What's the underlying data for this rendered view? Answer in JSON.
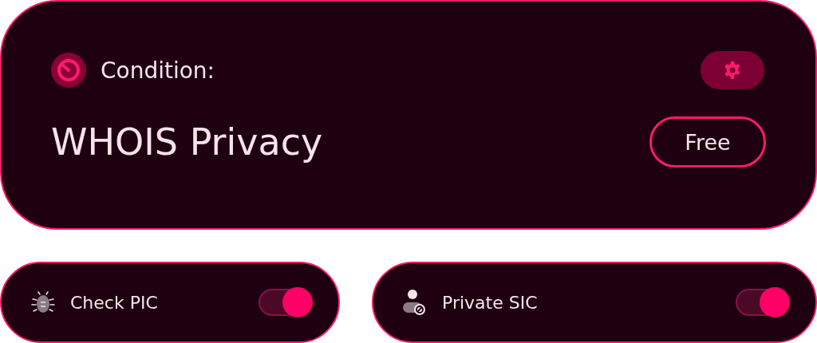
{
  "condition_card": {
    "label": "Condition:",
    "title": "WHOIS Privacy",
    "price_badge": "Free"
  },
  "toggles": [
    {
      "label": "Check PIC",
      "on": true
    },
    {
      "label": "Private SIC",
      "on": true
    }
  ]
}
